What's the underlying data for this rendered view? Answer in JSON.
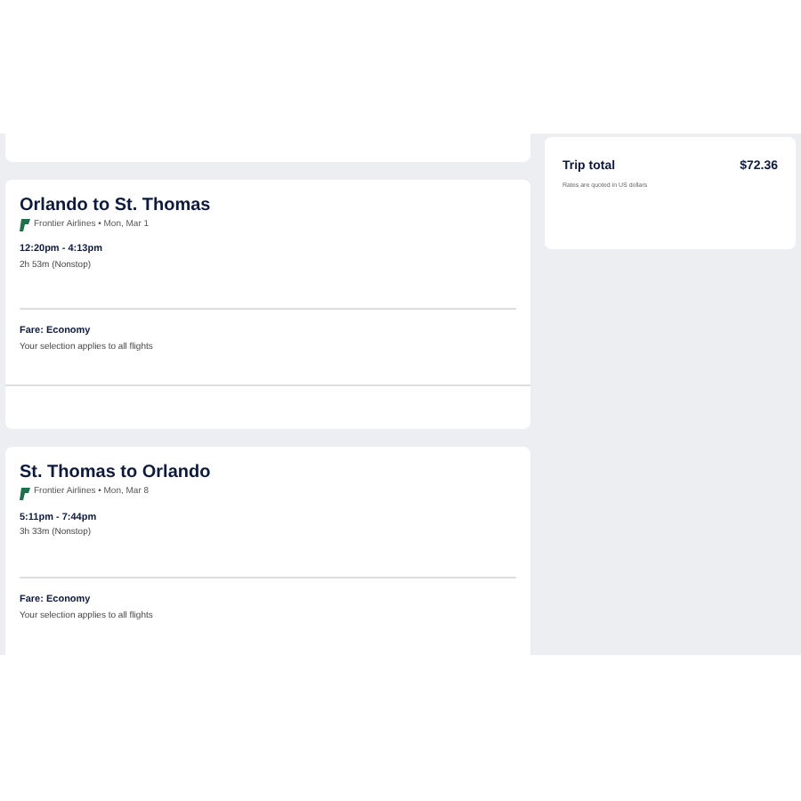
{
  "flights": [
    {
      "route": "Orlando to St. Thomas",
      "airline": "Frontier Airlines • Mon, Mar 1",
      "times": "12:20pm - 4:13pm",
      "duration": "2h 53m (Nonstop)",
      "fare": "Fare: Economy",
      "note": "Your selection applies to all flights",
      "footer": true
    },
    {
      "route": "St. Thomas to Orlando",
      "airline": "Frontier Airlines • Mon, Mar 8",
      "times": "5:11pm - 7:44pm",
      "duration": "3h 33m (Nonstop)",
      "fare": "Fare: Economy",
      "note": "Your selection applies to all flights",
      "footer": false
    }
  ],
  "summary": {
    "label": "Trip total",
    "amount": "$72.36",
    "note": "Rates are quoted in US dollars"
  }
}
